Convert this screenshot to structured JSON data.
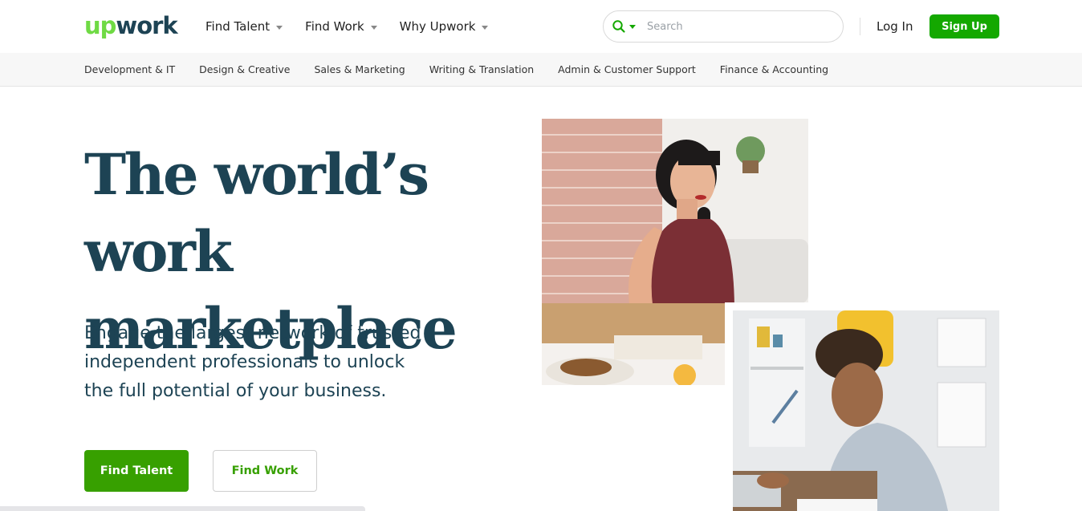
{
  "logo": {
    "part1": "up",
    "part2": "work"
  },
  "nav": {
    "items": [
      {
        "label": "Find Talent"
      },
      {
        "label": "Find Work"
      },
      {
        "label": "Why Upwork"
      }
    ]
  },
  "search": {
    "placeholder": "Search"
  },
  "auth": {
    "login": "Log In",
    "signup": "Sign Up"
  },
  "categories": [
    "Development & IT",
    "Design & Creative",
    "Sales & Marketing",
    "Writing & Translation",
    "Admin & Customer Support",
    "Finance & Accounting"
  ],
  "hero": {
    "title_line1": "The world’s work",
    "title_line2": "marketplace",
    "subtitle_line1": "Engage the largest network of trusted",
    "subtitle_line2": "independent professionals to unlock",
    "subtitle_line3": "the full potential of your business.",
    "cta_primary": "Find Talent",
    "cta_secondary": "Find Work"
  },
  "colors": {
    "brand_green": "#37a000",
    "heading_navy": "#1d4354"
  },
  "icons": {
    "search": "search-icon",
    "caret": "caret-down-icon"
  }
}
